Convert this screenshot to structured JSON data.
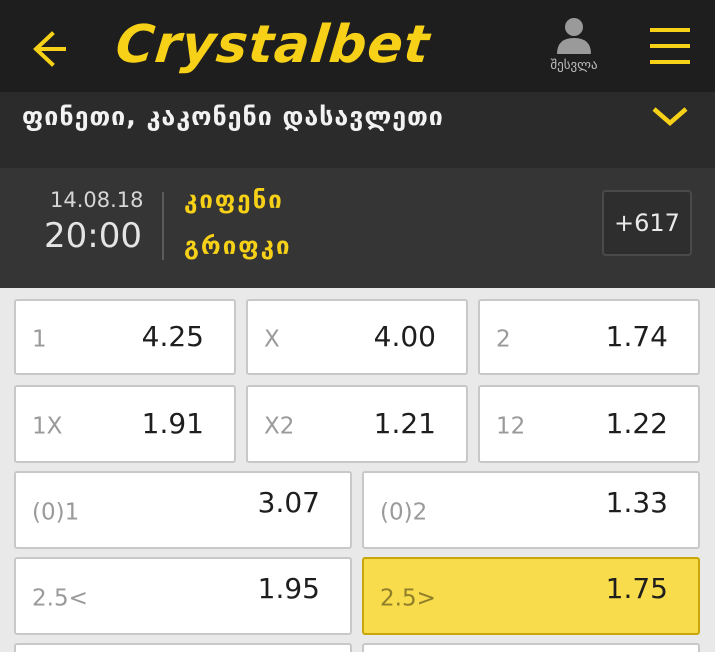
{
  "header": {
    "logo_text": "Crystalbet",
    "login_label": "შესვლა",
    "colors": {
      "background": "#1e1e1e",
      "brand": "#f7d117"
    },
    "icons": [
      "arrow-left-icon",
      "user-icon",
      "hamburger-menu-icon"
    ]
  },
  "league": {
    "title": "ფინეთი, კაკონენი დასავლეთი",
    "toggle_icon": "chevron-down-icon"
  },
  "match": {
    "date": "14.08.18",
    "time": "20:00",
    "home_team": "კიფენი",
    "away_team": "გრიფკი",
    "more_markets": "+617"
  },
  "odds": [
    {
      "label": "1",
      "value": "4.25"
    },
    {
      "label": "X",
      "value": "4.00"
    },
    {
      "label": "2",
      "value": "1.74"
    },
    {
      "label": "1X",
      "value": "1.91"
    },
    {
      "label": "X2",
      "value": "1.21"
    },
    {
      "label": "12",
      "value": "1.22"
    },
    {
      "label": "(0)1",
      "value": "3.07"
    },
    {
      "label": "(0)2",
      "value": "1.33"
    },
    {
      "label": "2.5<",
      "value": "1.95"
    },
    {
      "label": "2.5>",
      "value": "1.75",
      "selected": true
    }
  ],
  "colors": {
    "selected_odd": "#f9dc4c",
    "odd_background": "#ffffff",
    "page_background": "#e9e9e9"
  }
}
